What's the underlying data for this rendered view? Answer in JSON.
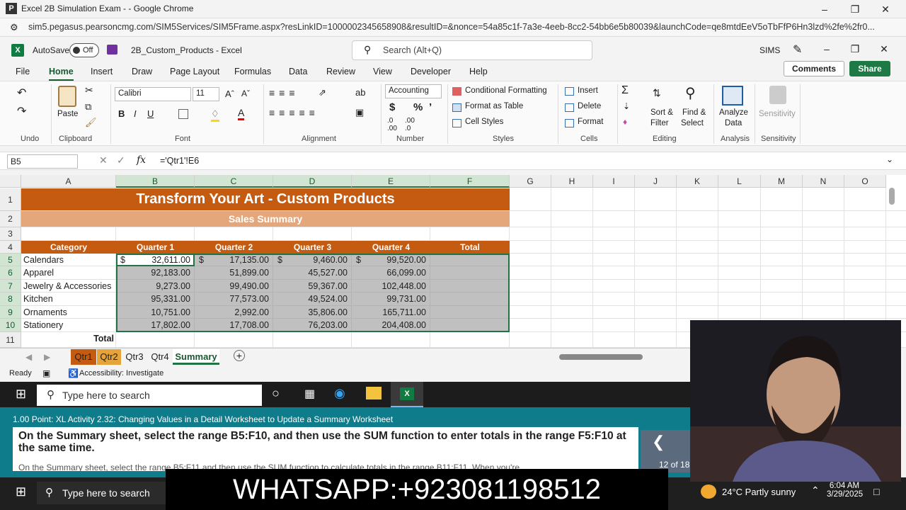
{
  "chrome": {
    "title": "Excel 2B Simulation Exam - - Google Chrome",
    "url": "sim5.pegasus.pearsoncmg.com/SIM5Services/SIM5Frame.aspx?resLinkID=1000002345658908&resultID=&nonce=54a85c1f-7a3e-4eeb-8cc2-54bb6e5b80039&launchCode=qe8mtdEeV5oTbFfP6Hn3lzd%2fe%2fr0..."
  },
  "excel": {
    "autosave_label": "AutoSave",
    "autosave_state": "Off",
    "filename": "2B_Custom_Products - Excel",
    "search_placeholder": "Search (Alt+Q)",
    "user": "SIMS",
    "menu": [
      "File",
      "Home",
      "Insert",
      "Draw",
      "Page Layout",
      "Formulas",
      "Data",
      "Review",
      "View",
      "Developer",
      "Help"
    ],
    "comments_label": "Comments",
    "share_label": "Share"
  },
  "ribbon": {
    "undo_label": "Undo",
    "clipboard_label": "Clipboard",
    "paste_label": "Paste",
    "font_label": "Font",
    "font_name": "Calibri",
    "font_size": "11",
    "alignment_label": "Alignment",
    "number_label": "Number",
    "number_format": "Accounting",
    "styles_label": "Styles",
    "conditional_formatting": "Conditional Formatting",
    "format_as_table": "Format as Table",
    "cell_styles": "Cell Styles",
    "cells_label": "Cells",
    "insert": "Insert",
    "delete": "Delete",
    "format": "Format",
    "editing_label": "Editing",
    "sort_filter_1": "Sort &",
    "sort_filter_2": "Filter",
    "find_select_1": "Find &",
    "find_select_2": "Select",
    "analysis_label": "Analysis",
    "analyze_data_1": "Analyze",
    "analyze_data_2": "Data",
    "sensitivity_label": "Sensitivity",
    "sensitivity_btn": "Sensitivity"
  },
  "formula_bar": {
    "name_box": "B5",
    "formula": "='Qtr1'!E6"
  },
  "sheet": {
    "columns": [
      "A",
      "B",
      "C",
      "D",
      "E",
      "F",
      "G",
      "H",
      "I",
      "J",
      "K",
      "L",
      "M",
      "N",
      "O"
    ],
    "rows": [
      "1",
      "2",
      "3",
      "4",
      "5",
      "6",
      "7",
      "8",
      "9",
      "10",
      "11"
    ],
    "title": "Transform Your Art - Custom Products",
    "subtitle": "Sales Summary",
    "headers": [
      "Category",
      "Quarter 1",
      "Quarter 2",
      "Quarter 3",
      "Quarter 4",
      "Total"
    ],
    "data": [
      {
        "category": "Calendars",
        "q1": "32,611.00",
        "q2": "17,135.00",
        "q3": "9,460.00",
        "q4": "99,520.00"
      },
      {
        "category": "Apparel",
        "q1": "92,183.00",
        "q2": "51,899.00",
        "q3": "45,527.00",
        "q4": "66,099.00"
      },
      {
        "category": "Jewelry & Accessories",
        "q1": "9,273.00",
        "q2": "99,490.00",
        "q3": "59,367.00",
        "q4": "102,448.00"
      },
      {
        "category": "Kitchen",
        "q1": "95,331.00",
        "q2": "77,573.00",
        "q3": "49,524.00",
        "q4": "99,731.00"
      },
      {
        "category": "Ornaments",
        "q1": "10,751.00",
        "q2": "2,992.00",
        "q3": "35,806.00",
        "q4": "165,711.00"
      },
      {
        "category": "Stationery",
        "q1": "17,802.00",
        "q2": "17,708.00",
        "q3": "76,203.00",
        "q4": "204,408.00"
      }
    ],
    "currency_symbol": "$",
    "total_label": "Total"
  },
  "tabs": [
    "Qtr1",
    "Qtr2",
    "Qtr3",
    "Qtr4",
    "Summary"
  ],
  "status": {
    "ready": "Ready",
    "accessibility": "Accessibility: Investigate"
  },
  "taskbar": {
    "search_placeholder": "Type here to search",
    "weather": "24°C  Partly sunny",
    "time": "6:04 AM",
    "date": "3/29/2025"
  },
  "instructions": {
    "header": "1.00 Point: XL Activity 2.32: Changing Values in a Detail Worksheet to Update a Summary Worksheet",
    "task": "On the Summary sheet, select the range B5:F10, and then use the SUM function to enter totals in the range F5:F10 at the same time.",
    "task_preview": "On the Summary sheet, select the range B5:F11 and then use the SUM function to calculate totals in the range B11:F11. When you're...",
    "page": "12 of 18"
  },
  "overlay": {
    "whatsapp": "WHATSAPP:+923081198512"
  },
  "colors": {
    "title_fill": "#c55a11",
    "subtitle_fill": "#e4a77c",
    "excel_green": "#217346",
    "instructions_bg": "#0e7c8b"
  }
}
